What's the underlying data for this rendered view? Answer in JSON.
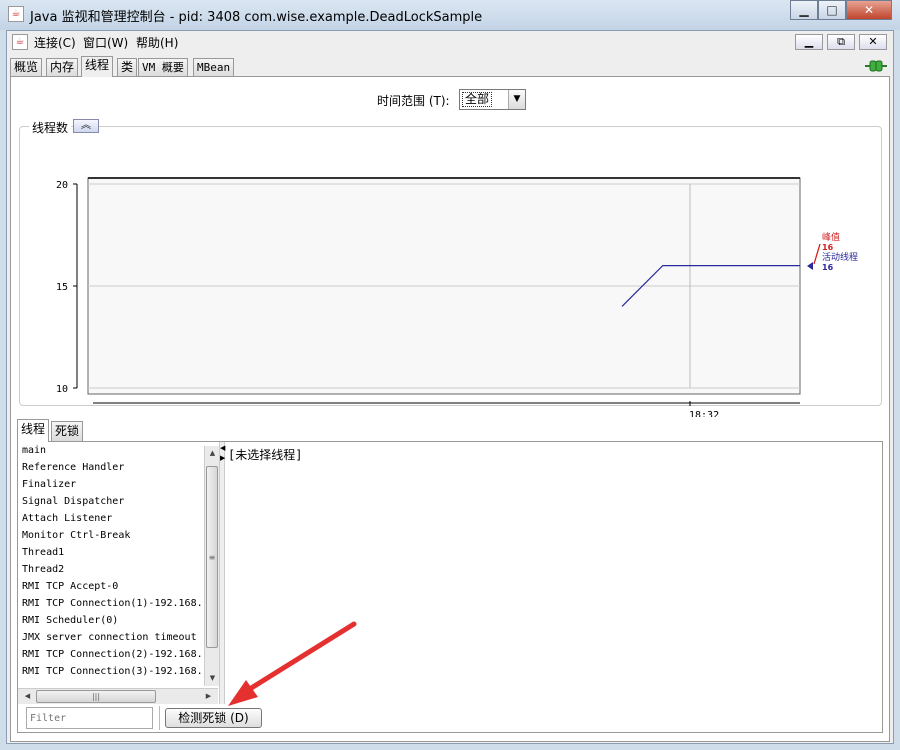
{
  "window": {
    "title": "Java 监视和管理控制台 - pid: 3408 com.wise.example.DeadLockSample",
    "icon": "java-cup-icon",
    "controls": {
      "minimize": "▁",
      "maximize": "□",
      "close": "✕"
    }
  },
  "menubar": {
    "items": [
      "连接(C)",
      "窗口(W)",
      "帮助(H)"
    ],
    "mdi_controls": {
      "minimize": "▁",
      "restore": "⧉",
      "close": "✕"
    }
  },
  "tabs": [
    {
      "label": "概览"
    },
    {
      "label": "内存"
    },
    {
      "label": "线程",
      "active": true
    },
    {
      "label": "类"
    },
    {
      "label": "VM 概要"
    },
    {
      "label": "MBean"
    }
  ],
  "connection_icon": "connection-status-icon",
  "time_range": {
    "label": "时间范围 (T):",
    "selected": "全部"
  },
  "chart_panel": {
    "title": "线程数",
    "collapse_icon": "double-chevron-up-icon"
  },
  "chart_data": {
    "type": "line",
    "title": "",
    "xlabel": "",
    "ylabel": "",
    "ylim": [
      10,
      20
    ],
    "yticks": [
      10,
      15,
      20
    ],
    "xticks": [
      "18:32"
    ],
    "grid": true,
    "legend_placement": "right",
    "series": [
      {
        "name": "峰值",
        "color": "#d42020",
        "current": 16,
        "values": []
      },
      {
        "name": "活动线程",
        "color": "#2a2a9a",
        "current": 16,
        "points": [
          {
            "t": 0.0,
            "v": 14
          },
          {
            "t": 0.055,
            "v": 16
          },
          {
            "t": 0.24,
            "v": 16
          }
        ]
      }
    ]
  },
  "legend": [
    {
      "name": "峰值",
      "value": "16",
      "color": "#d42020"
    },
    {
      "name": "活动线程",
      "value": "16",
      "color": "#2a2a9a"
    }
  ],
  "lower_tabs": [
    {
      "label": "线程",
      "active": true
    },
    {
      "label": "死锁"
    }
  ],
  "threads": [
    "main",
    "Reference Handler",
    "Finalizer",
    "Signal Dispatcher",
    "Attach Listener",
    "Monitor Ctrl-Break",
    "Thread1",
    "Thread2",
    "RMI TCP Accept-0",
    "RMI TCP Connection(1)-192.168.",
    "RMI Scheduler(0)",
    "JMX server connection timeout",
    "RMI TCP Connection(2)-192.168.",
    "RMI TCP Connection(3)-192.168."
  ],
  "detail_text": "[未选择线程]",
  "filter_placeholder": "Filter",
  "detect_button": "检测死锁 (D)"
}
